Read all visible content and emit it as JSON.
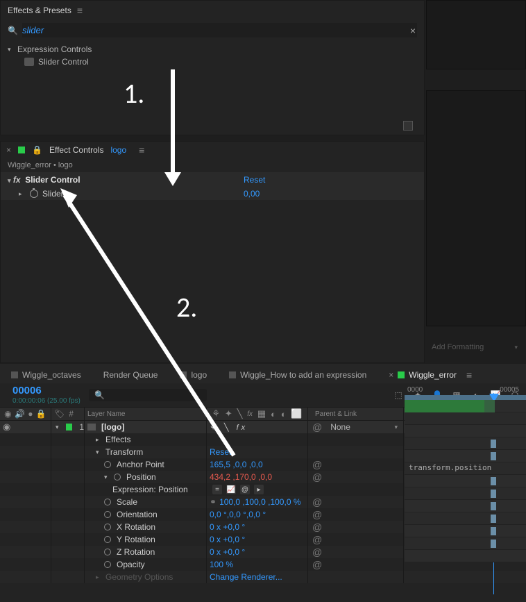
{
  "effects_presets": {
    "title": "Effects & Presets",
    "search_value": "slider",
    "category": "Expression Controls",
    "item": "Slider Control"
  },
  "effect_controls": {
    "title": "Effect Controls",
    "layer_name": "logo",
    "breadcrumb": "Wiggle_error • logo",
    "effect_name": "Slider Control",
    "reset": "Reset",
    "prop_label": "Slider",
    "prop_value": "0,00"
  },
  "right": {
    "add_formatting": "Add Formatting"
  },
  "annotations": {
    "n1": "1.",
    "n2": "2."
  },
  "timeline": {
    "tabs": [
      "Wiggle_octaves",
      "Render Queue",
      "logo",
      "Wiggle_How to add an expression",
      "Wiggle_error"
    ],
    "active_tab": 4,
    "frame": "00006",
    "timecode": "0:00:00:06 (25.00 fps)",
    "ruler": [
      "0000",
      "00005"
    ],
    "headers": {
      "layer_name": "Layer Name",
      "parent": "Parent & Link"
    },
    "layer": {
      "index": "1",
      "name": "[logo]",
      "parent": "None"
    },
    "groups": {
      "effects": "Effects",
      "transform": "Transform",
      "transform_reset": "Reset",
      "geometry": "Geometry Options",
      "change_renderer": "Change Renderer..."
    },
    "props": [
      {
        "name": "Anchor Point",
        "value": "165,5 ,0,0 ,0,0",
        "blue": true,
        "kf": true
      },
      {
        "name": "Position",
        "value": "434,2 ,170,0 ,0,0",
        "red": true,
        "kf": true,
        "twirl": true
      },
      {
        "name": "Scale",
        "value": "100,0 ,100,0 ,100,0 %",
        "blue": true,
        "link": true,
        "kf": true
      },
      {
        "name": "Orientation",
        "value": "0,0 °,0,0 °,0,0 °",
        "blue": true,
        "kf": true
      },
      {
        "name": "X Rotation",
        "value": "0 x +0,0 °",
        "blue": true,
        "kf": true
      },
      {
        "name": "Y Rotation",
        "value": "0 x +0,0 °",
        "blue": true,
        "kf": true
      },
      {
        "name": "Z Rotation",
        "value": "0 x +0,0 °",
        "blue": true,
        "kf": true
      },
      {
        "name": "Opacity",
        "value": "100 %",
        "blue": true,
        "kf": true
      }
    ],
    "expression_label": "Expression: Position",
    "expression_code": "transform.position"
  }
}
